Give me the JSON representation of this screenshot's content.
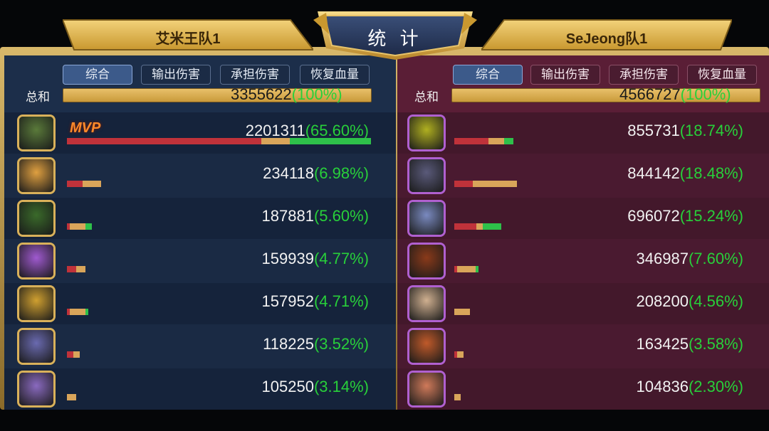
{
  "title": "统 计",
  "teams": {
    "left": {
      "name": "艾米王队1",
      "tabs": [
        "综合",
        "输出伤害",
        "承担伤害",
        "恢复血量"
      ],
      "active_tab": 0,
      "total_label": "总和",
      "total_value": "3355622",
      "total_pct": "(100%)",
      "rows": [
        {
          "value": "2201311",
          "pct": "(65.60%)",
          "mvp": "MVP",
          "avatar": "green-orc-hero-icon",
          "color": "#5a7a3a",
          "bars": [
            0.62,
            0.09,
            0.26
          ]
        },
        {
          "value": "234118",
          "pct": "(6.98%)",
          "avatar": "blonde-elf-hero-icon",
          "color": "#e0a040",
          "bars": [
            0.05,
            0.06,
            0
          ]
        },
        {
          "value": "187881",
          "pct": "(5.60%)",
          "avatar": "tree-spirit-hero-icon",
          "color": "#3a6a2a",
          "bars": [
            0.01,
            0.05,
            0.02
          ]
        },
        {
          "value": "159939",
          "pct": "(4.77%)",
          "avatar": "purple-haired-hero-icon",
          "color": "#a05ad0",
          "bars": [
            0.03,
            0.03,
            0
          ]
        },
        {
          "value": "157952",
          "pct": "(4.71%)",
          "avatar": "golden-beast-hero-icon",
          "color": "#d0a030",
          "bars": [
            0.01,
            0.05,
            0.01
          ]
        },
        {
          "value": "118225",
          "pct": "(3.52%)",
          "avatar": "armored-knight-hero-icon",
          "color": "#6a6ab0",
          "bars": [
            0.02,
            0.02,
            0
          ]
        },
        {
          "value": "105250",
          "pct": "(3.14%)",
          "avatar": "dark-rider-hero-icon",
          "color": "#8a6ac0",
          "bars": [
            0,
            0.03,
            0
          ]
        }
      ]
    },
    "right": {
      "name": "SeJeong队1",
      "tabs": [
        "综合",
        "输出伤害",
        "承担伤害",
        "恢复血量"
      ],
      "active_tab": 0,
      "total_label": "总和",
      "total_value": "4566727",
      "total_pct": "(100%)",
      "rows": [
        {
          "value": "855731",
          "pct": "(18.74%)",
          "avatar": "lightning-creature-hero-icon",
          "color": "#b0b020",
          "bars": [
            0.11,
            0.05,
            0.03
          ]
        },
        {
          "value": "844142",
          "pct": "(18.48%)",
          "avatar": "masked-warrior-hero-icon",
          "color": "#5a5a7a",
          "bars": [
            0.06,
            0.14,
            0
          ]
        },
        {
          "value": "696072",
          "pct": "(15.24%)",
          "avatar": "blue-sorceress-hero-icon",
          "color": "#7a8ac0",
          "bars": [
            0.07,
            0.02,
            0.06
          ]
        },
        {
          "value": "346987",
          "pct": "(7.60%)",
          "avatar": "lava-demon-hero-icon",
          "color": "#8a3a1a",
          "bars": [
            0.01,
            0.06,
            0.01
          ]
        },
        {
          "value": "208200",
          "pct": "(4.56%)",
          "avatar": "white-haired-hero-icon",
          "color": "#d0b090",
          "bars": [
            0,
            0.05,
            0
          ]
        },
        {
          "value": "163425",
          "pct": "(3.58%)",
          "avatar": "horned-beast-hero-icon",
          "color": "#c05a2a",
          "bars": [
            0.01,
            0.02,
            0
          ]
        },
        {
          "value": "104836",
          "pct": "(2.30%)",
          "avatar": "red-eyed-girl-hero-icon",
          "color": "#d07a5a",
          "bars": [
            0,
            0.02,
            0
          ]
        }
      ]
    }
  },
  "colors": {
    "left_panel": "#1a2a44",
    "right_panel": "#4a1a30",
    "gold": "#d9b15a",
    "percent_green": "#28d03a"
  }
}
